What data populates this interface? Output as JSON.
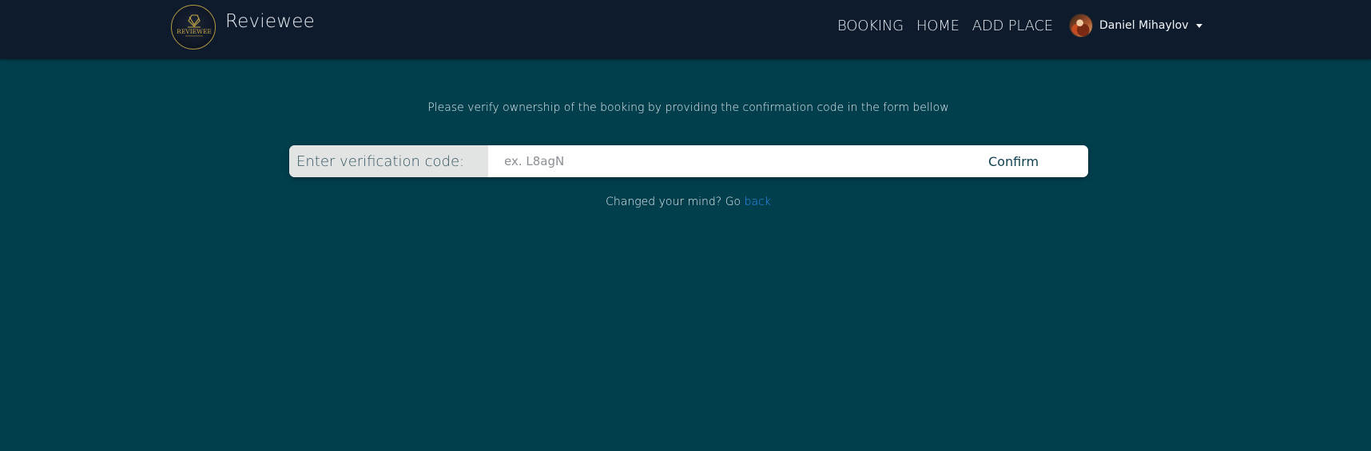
{
  "brand": {
    "logo_text": "REVIEWEE",
    "name": "Reviewee"
  },
  "nav": {
    "links": [
      {
        "label": "BOOKING"
      },
      {
        "label": "HOME"
      },
      {
        "label": "ADD PLACE"
      }
    ],
    "user": {
      "name": "Daniel Mihaylov"
    }
  },
  "verify": {
    "instructions": "Please verify ownership of the booking by providing the confirmation code in the form bellow",
    "label": "Enter verification code:",
    "placeholder": "ex. L8agN",
    "value": "",
    "confirm_label": "Confirm",
    "back_prefix": "Changed your mind? Go ",
    "back_link": "back"
  },
  "colors": {
    "navbar_bg": "#0e1b2c",
    "page_bg": "#013f4d",
    "logo_gold": "#b59a45",
    "link_blue": "#2f8cf4"
  }
}
